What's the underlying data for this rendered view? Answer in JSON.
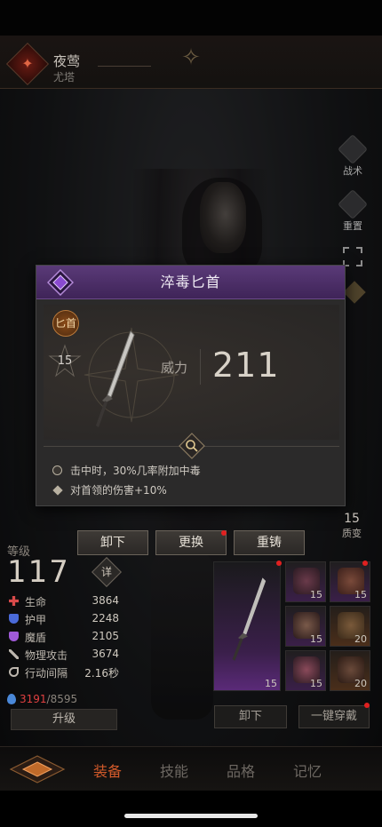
{
  "header": {
    "hero_name": "夜莺",
    "hero_subtitle": "尤塔"
  },
  "side_buttons": [
    {
      "label": "战术"
    },
    {
      "label": "重置"
    }
  ],
  "popup": {
    "title": "淬毒匕首",
    "weapon_type": "匕首",
    "level": "15",
    "power_label": "威力",
    "power_value": "211",
    "effects": [
      "击中时，30%几率附加中毒",
      "对首领的伤害+10%"
    ],
    "accent_color": "#4a2d66"
  },
  "actions": {
    "unequip": "卸下",
    "replace": "更换",
    "recast": "重铸"
  },
  "quality": {
    "value": "15",
    "label": "质变"
  },
  "stats": {
    "level_label": "等级",
    "level_value": "117",
    "detail_label": "详",
    "rows": [
      {
        "name": "生命",
        "value": "3864",
        "icon": "heart-cross-icon",
        "color": "#d84a4a"
      },
      {
        "name": "护甲",
        "value": "2248",
        "icon": "shield-icon",
        "color": "#4a6ad8"
      },
      {
        "name": "魔盾",
        "value": "2105",
        "icon": "magic-shield-icon",
        "color": "#a05ad8"
      },
      {
        "name": "物理攻击",
        "value": "3674",
        "icon": "sword-icon",
        "color": "#bdb7ae"
      },
      {
        "name": "行动间隔",
        "value": "2.16秒",
        "icon": "speed-icon",
        "color": "#bdb7ae"
      }
    ],
    "mana_current": "3191",
    "mana_max": "/8595",
    "upgrade_label": "升级"
  },
  "equipment": {
    "main_slot_level": "15",
    "slots": [
      {
        "level": "15",
        "rarity": "purple",
        "item": "helmet-icon"
      },
      {
        "level": "15",
        "rarity": "purple",
        "item": "armor-icon"
      },
      {
        "level": "15",
        "rarity": "purple",
        "item": "gauntlet-icon"
      },
      {
        "level": "20",
        "rarity": "orange",
        "item": "bracer-icon"
      },
      {
        "level": "15",
        "rarity": "purple",
        "item": "belt-icon"
      },
      {
        "level": "20",
        "rarity": "orange",
        "item": "boots-icon"
      }
    ],
    "unequip_all": "卸下",
    "quick_equip": "一键穿戴"
  },
  "nav": {
    "tabs": [
      "装备",
      "技能",
      "品格",
      "记忆"
    ]
  }
}
